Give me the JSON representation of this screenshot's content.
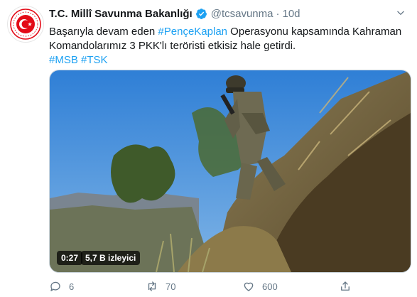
{
  "account": {
    "display_name": "T.C. Millî Savunma Bakanlığı",
    "handle": "@tcsavunma",
    "separator": "·",
    "time_ago": "10d",
    "avatar_icon": "msb-emblem-icon",
    "verified_icon": "verified-badge-icon"
  },
  "tweet": {
    "text_part1": "Başarıyla devam eden ",
    "hashtag_main": "#PençeKaplan",
    "text_part2": " Operasyonu kapsamında Kahraman Komandolarımız 3 PKK'lı teröristi etkisiz hale getirdi.",
    "hashtags": [
      "#MSB",
      "#TSK"
    ]
  },
  "media": {
    "duration": "0:27",
    "views": "5,7 B izleyici"
  },
  "actions": {
    "reply_count": "6",
    "retweet_count": "70",
    "like_count": "600"
  },
  "colors": {
    "link": "#1da1f2",
    "secondary_text": "#657786",
    "emblem_red": "#e30a17"
  }
}
